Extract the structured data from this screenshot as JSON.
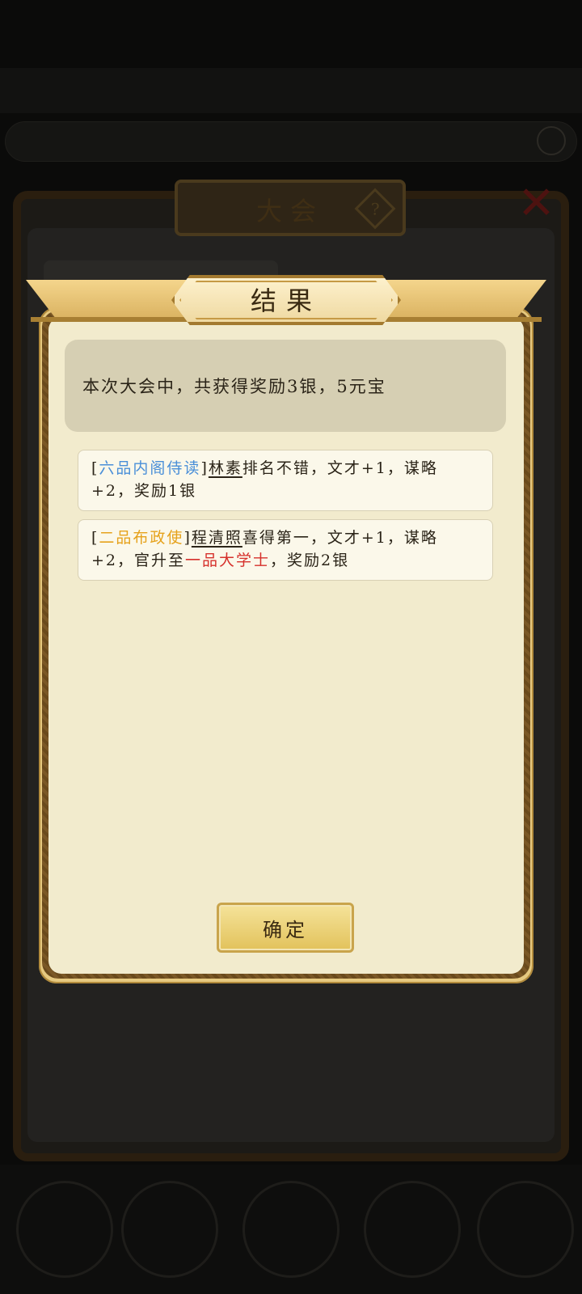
{
  "background": {
    "panel_title": "大会",
    "help_glyph": "?",
    "close_glyph": "✕"
  },
  "dialog": {
    "title": "结果",
    "summary": "本次大会中，共获得奖励3银，5元宝",
    "records": [
      {
        "open_bracket": "[",
        "rank": "六品内阁侍读",
        "rank_color": "#4a8fd8",
        "close_bracket": "]",
        "name": "林素",
        "text_line1": "排名不错，文才+1，谋略",
        "text_line2": "+2，奖励1银"
      },
      {
        "open_bracket": "[",
        "rank": "二品布政使",
        "rank_color": "#e6a21c",
        "close_bracket": "]",
        "name": "程清照",
        "text_line1": "喜得第一，文才+1，谋略",
        "text_line2_prefix": "+2，官升至",
        "promotion": "一品大学士",
        "promotion_color": "#d6302b",
        "text_line2_suffix": "，奖励2银"
      }
    ],
    "confirm_label": "确定"
  }
}
